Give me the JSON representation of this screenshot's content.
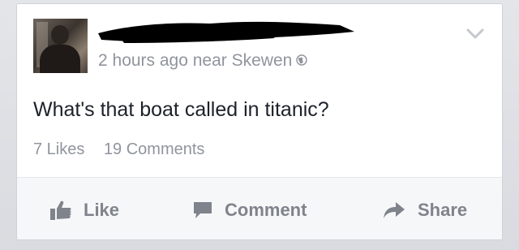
{
  "post": {
    "timestamp": "2 hours ago near Skewen",
    "privacy_icon": "globe-icon",
    "message": "What's that boat called in titanic?",
    "likes_count": "7 Likes",
    "comments_count": "19 Comments"
  },
  "actions": {
    "like_label": "Like",
    "comment_label": "Comment",
    "share_label": "Share"
  },
  "colors": {
    "meta_text": "#90949c",
    "body_text": "#1d2129",
    "action_text": "#7f838b",
    "redaction": "#000000"
  }
}
